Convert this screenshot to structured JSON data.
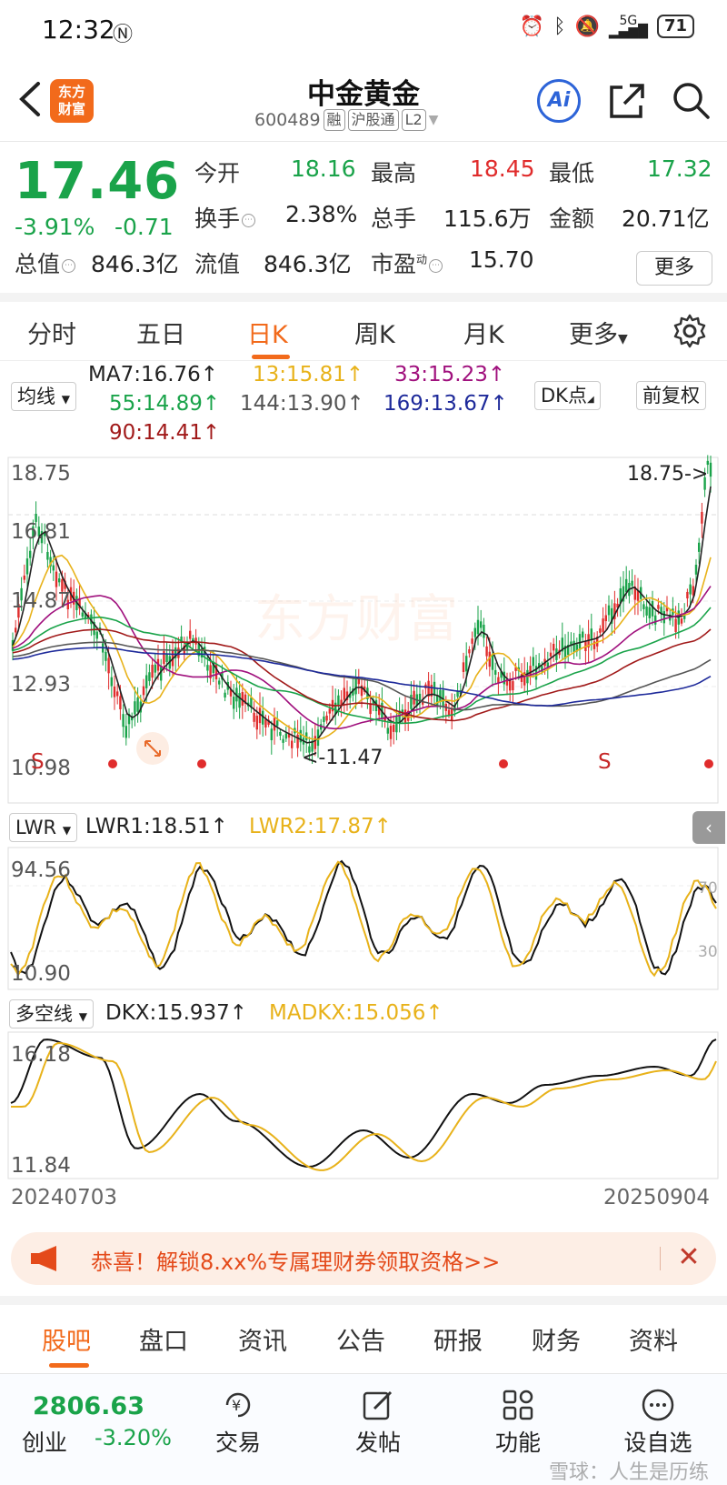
{
  "status_bar": {
    "time": "12:32",
    "battery": "71",
    "signal": "5G"
  },
  "header": {
    "stock_name": "中金黄金",
    "code": "600489",
    "tags": [
      "融",
      "沪股通",
      "L2"
    ],
    "logo_text": [
      "东方",
      "财富"
    ],
    "ai_label": "Ai"
  },
  "quote": {
    "price": "17.46",
    "change_pct": "-3.91%",
    "change": "-0.71",
    "open_label": "今开",
    "open": "18.16",
    "high_label": "最高",
    "high": "18.45",
    "low_label": "最低",
    "low": "17.32",
    "turnover_label": "换手",
    "turnover": "2.38%",
    "volume_label": "总手",
    "volume": "115.6万",
    "amount_label": "金额",
    "amount": "20.71亿",
    "mcap_label": "总值",
    "mcap": "846.3亿",
    "float_label": "流值",
    "float": "846.3亿",
    "pe_label": "市盈",
    "pe_sup": "动",
    "pe": "15.70",
    "more_label": "更多"
  },
  "tabs": [
    "分时",
    "五日",
    "日K",
    "周K",
    "月K",
    "更多"
  ],
  "ma": {
    "selector": "均线",
    "ma7": "MA7:16.76↑",
    "ma13": "13:15.81↑",
    "ma33": "33:15.23↑",
    "ma55": "55:14.89↑",
    "ma144": "144:13.90↑",
    "ma169": "169:13.67↑",
    "ma90": "90:14.41↑",
    "dk": "DK点",
    "adjust": "前复权"
  },
  "kchart": {
    "y_labels": [
      "18.75",
      "16.81",
      "14.87",
      "12.93",
      "10.98"
    ],
    "high_marker": "18.75->",
    "low_marker": "<-11.47",
    "watermark": "东方财富",
    "signal_s": "S"
  },
  "lwr": {
    "selector": "LWR",
    "lwr1": "LWR1:18.51↑",
    "lwr2": "LWR2:17.87↑",
    "y_top": "94.56",
    "y_bottom": "10.90",
    "ref70": "70",
    "ref30": "30"
  },
  "dkx": {
    "selector": "多空线",
    "dkx": "DKX:15.937↑",
    "madkx": "MADKX:15.056↑",
    "y_top": "16.18",
    "y_bottom": "11.84"
  },
  "dates": {
    "start": "20240703",
    "end": "20250904"
  },
  "banner": {
    "text": "恭喜！解锁8.xx%专属理财券领取资格>>"
  },
  "bottom_tabs": [
    "股吧",
    "盘口",
    "资讯",
    "公告",
    "研报",
    "财务",
    "资料"
  ],
  "bottom_nav": {
    "index_value": "2806.63",
    "index_name": "创业",
    "index_change": "-3.20%",
    "items": [
      "交易",
      "发帖",
      "功能",
      "设自选"
    ],
    "watermark": "雪球：人生是历练"
  },
  "colors": {
    "up": "#e02c2c",
    "down": "#1aa34a",
    "accent": "#f26a1b"
  }
}
